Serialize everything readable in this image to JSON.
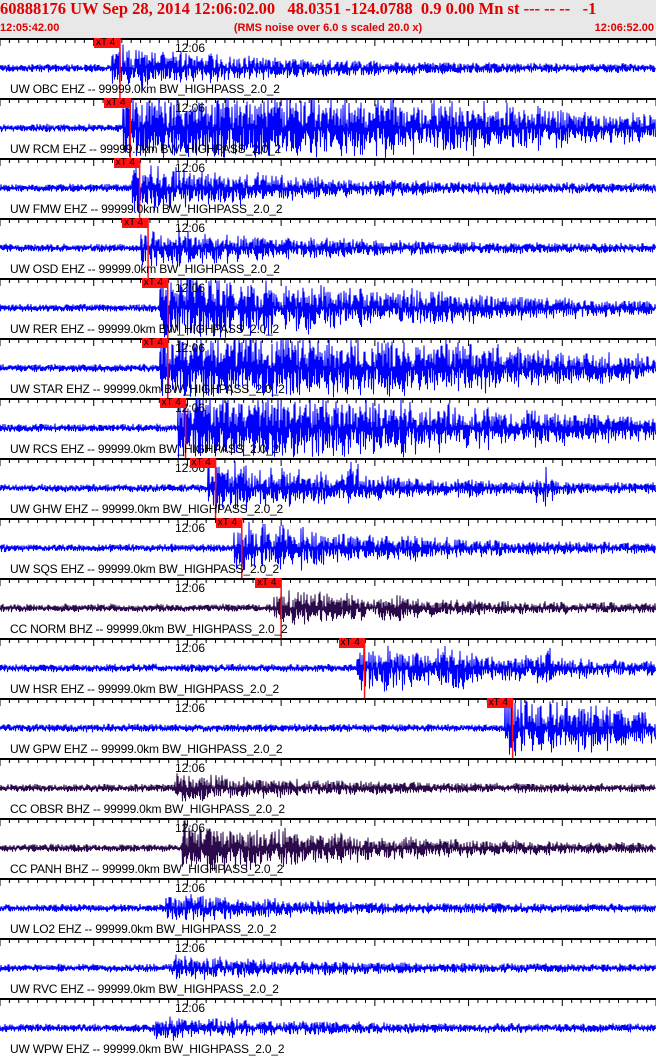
{
  "header": {
    "title": "60888176 UW Sep 28, 2014 12:06:02.00   48.0351 -124.0788  0.9 0.00 Mn st --- -- --   -1",
    "start_time": "12:05:42.00",
    "end_time": "12:06:52.00",
    "note": "(RMS noise over 6.0 s scaled 20.0 x)"
  },
  "time_tick_label": "12:06",
  "window_seconds": 70,
  "colors": {
    "uw": "#0000ff",
    "cc": "#2a0a4a",
    "pick": "#ff1010",
    "header": "#e00000"
  },
  "traces": [
    {
      "label": "UW OBC EHZ -- 99999.0km BW_HIGHPASS_2.0_2",
      "net": "uw",
      "pick": "xT 4",
      "pick_s": 12.8,
      "amp": 0.25
    },
    {
      "label": "UW RCM EHZ -- 99999.0km BW_HIGHPASS_2.0_2",
      "net": "uw",
      "pick": "xT 4",
      "pick_s": 13.9,
      "amp": 1.0
    },
    {
      "label": "UW FMW EHZ -- 99999.0km BW_HIGHPASS_2.0_2",
      "net": "uw",
      "pick": "xT 4",
      "pick_s": 14.9,
      "amp": 0.3
    },
    {
      "label": "UW OSD EHZ -- 99999.0km BW_HIGHPASS_2.0_2",
      "net": "uw",
      "pick": "xT 4",
      "pick_s": 15.8,
      "amp": 0.25
    },
    {
      "label": "UW RER EHZ -- 99999.0km BW_HIGHPASS_2.0_2",
      "net": "uw",
      "pick": "xT 4",
      "pick_s": 17.9,
      "amp": 0.6
    },
    {
      "label": "UW STAR EHZ -- 99999.0km BW_HIGHPASS_2.0_2",
      "net": "uw",
      "pick": "xT 4",
      "pick_s": 17.9,
      "amp": 0.9
    },
    {
      "label": "UW RCS EHZ -- 99999.0km BW_HIGHPASS_2.0_2",
      "net": "uw",
      "pick": "xT 4",
      "pick_s": 19.8,
      "amp": 0.8
    },
    {
      "label": "UW GHW EHZ -- 99999.0km BW_HIGHPASS_2.0_2",
      "net": "uw",
      "pick": "xT 4",
      "pick_s": 23.0,
      "amp": 0.3
    },
    {
      "label": "UW SQS EHZ -- 99999.0km BW_HIGHPASS_2.0_2",
      "net": "uw",
      "pick": "xT 4",
      "pick_s": 25.8,
      "amp": 0.3
    },
    {
      "label": "CC NORM BHZ -- 99999.0km BW_HIGHPASS_2.0_2",
      "net": "cc",
      "pick": "xT 4",
      "pick_s": 30.0,
      "amp": 0.2
    },
    {
      "label": "UW HSR EHZ -- 99999.0km BW_HIGHPASS_2.0_2",
      "net": "uw",
      "pick": "xT 4",
      "pick_s": 38.9,
      "amp": 0.3
    },
    {
      "label": "UW GPW EHZ -- 99999.0km BW_HIGHPASS_2.0_2",
      "net": "uw",
      "pick": "xT 4",
      "pick_s": 54.7,
      "amp": 0.4
    },
    {
      "label": "CC OBSR BHZ -- 99999.0km BW_HIGHPASS_2.0_2",
      "net": "cc",
      "pick": null,
      "amp": 0.15
    },
    {
      "label": "CC PANH BHZ -- 99999.0km BW_HIGHPASS_2.0_2",
      "net": "cc",
      "pick": null,
      "amp": 0.35
    },
    {
      "label": "UW LO2 EHZ -- 99999.0km BW_HIGHPASS_2.0_2",
      "net": "uw",
      "pick": null,
      "amp": 0.15
    },
    {
      "label": "UW RVC EHZ -- 99999.0km BW_HIGHPASS_2.0_2",
      "net": "uw",
      "pick": null,
      "amp": 0.12
    },
    {
      "label": "UW WPW EHZ -- 99999.0km BW_HIGHPASS_2.0_2",
      "net": "uw",
      "pick": null,
      "amp": 0.12
    }
  ]
}
